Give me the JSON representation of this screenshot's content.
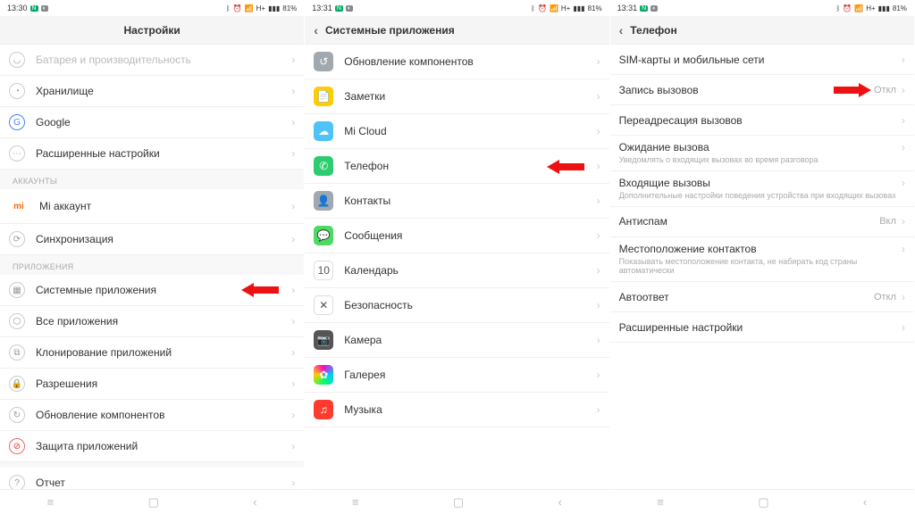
{
  "status": {
    "time1": "13:30",
    "time2": "13:31",
    "time3": "13:31",
    "right": "81%"
  },
  "s1": {
    "title": "Настройки",
    "rows": {
      "battery": "Батарея и производительность",
      "storage": "Хранилище",
      "google": "Google",
      "adv": "Расширенные настройки"
    },
    "accounts_header": "АККАУНТЫ",
    "accounts": {
      "mi": "Mi аккаунт",
      "sync": "Синхронизация"
    },
    "apps_header": "ПРИЛОЖЕНИЯ",
    "apps": {
      "system": "Системные приложения",
      "all": "Все приложения",
      "clone": "Клонирование приложений",
      "perm": "Разрешения",
      "update": "Обновление компонентов",
      "protect": "Защита приложений"
    },
    "report": "Отчет"
  },
  "s2": {
    "title": "Системные приложения",
    "rows": {
      "update": "Обновление компонентов",
      "notes": "Заметки",
      "micloud": "Mi Cloud",
      "phone": "Телефон",
      "contacts": "Контакты",
      "messages": "Сообщения",
      "calendar": "Календарь",
      "security": "Безопасность",
      "camera": "Камера",
      "gallery": "Галерея",
      "music": "Музыка"
    }
  },
  "s3": {
    "title": "Телефон",
    "rows": {
      "sim": "SIM-карты и мобильные сети",
      "rec": "Запись вызовов",
      "rec_val": "Откл",
      "fwd": "Переадресация вызовов",
      "wait": "Ожидание вызова",
      "wait_sub": "Уведомлять о входящих вызовах во время разговора",
      "incoming": "Входящие вызовы",
      "incoming_sub": "Дополнительные настройки поведения устройства при входящих вызовах",
      "spam": "Антиспам",
      "spam_val": "Вкл",
      "loc": "Местоположение контактов",
      "loc_sub": "Показывать местоположение контакта, не набирать код страны автоматически",
      "auto": "Автоответ",
      "auto_val": "Откл",
      "adv": "Расширенные настройки"
    }
  }
}
